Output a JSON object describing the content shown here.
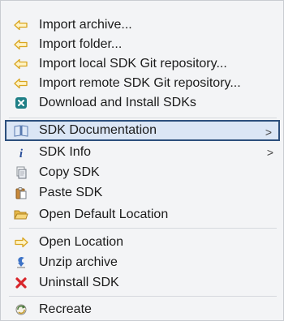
{
  "menu": {
    "items": [
      {
        "label": "Import archive...",
        "icon": "import-arrow-icon"
      },
      {
        "label": "Import folder...",
        "icon": "import-arrow-icon"
      },
      {
        "label": "Import local SDK Git repository...",
        "icon": "import-arrow-icon"
      },
      {
        "label": "Import remote SDK Git repository...",
        "icon": "import-arrow-icon"
      },
      {
        "label": "Download and Install SDKs",
        "icon": "download-install-icon"
      },
      {
        "label": "SDK Documentation",
        "icon": "book-icon",
        "submenu": true,
        "highlighted": true
      },
      {
        "label": "SDK Info",
        "icon": "info-icon",
        "submenu": true
      },
      {
        "label": "Copy SDK",
        "icon": "copy-icon"
      },
      {
        "label": "Paste SDK",
        "icon": "paste-icon"
      },
      {
        "label": "Open Default Location",
        "icon": "folder-icon"
      },
      {
        "label": "Open Location",
        "icon": "open-arrow-icon"
      },
      {
        "label": "Unzip archive",
        "icon": "unzip-icon"
      },
      {
        "label": "Uninstall SDK",
        "icon": "red-x-icon"
      },
      {
        "label": "Recreate",
        "icon": "recreate-icon"
      }
    ],
    "submenu_glyph": ">",
    "colors": {
      "highlight_bg": "#dbe6f5",
      "highlight_border": "#2c4f7c",
      "menu_bg": "#f3f4f6"
    }
  }
}
